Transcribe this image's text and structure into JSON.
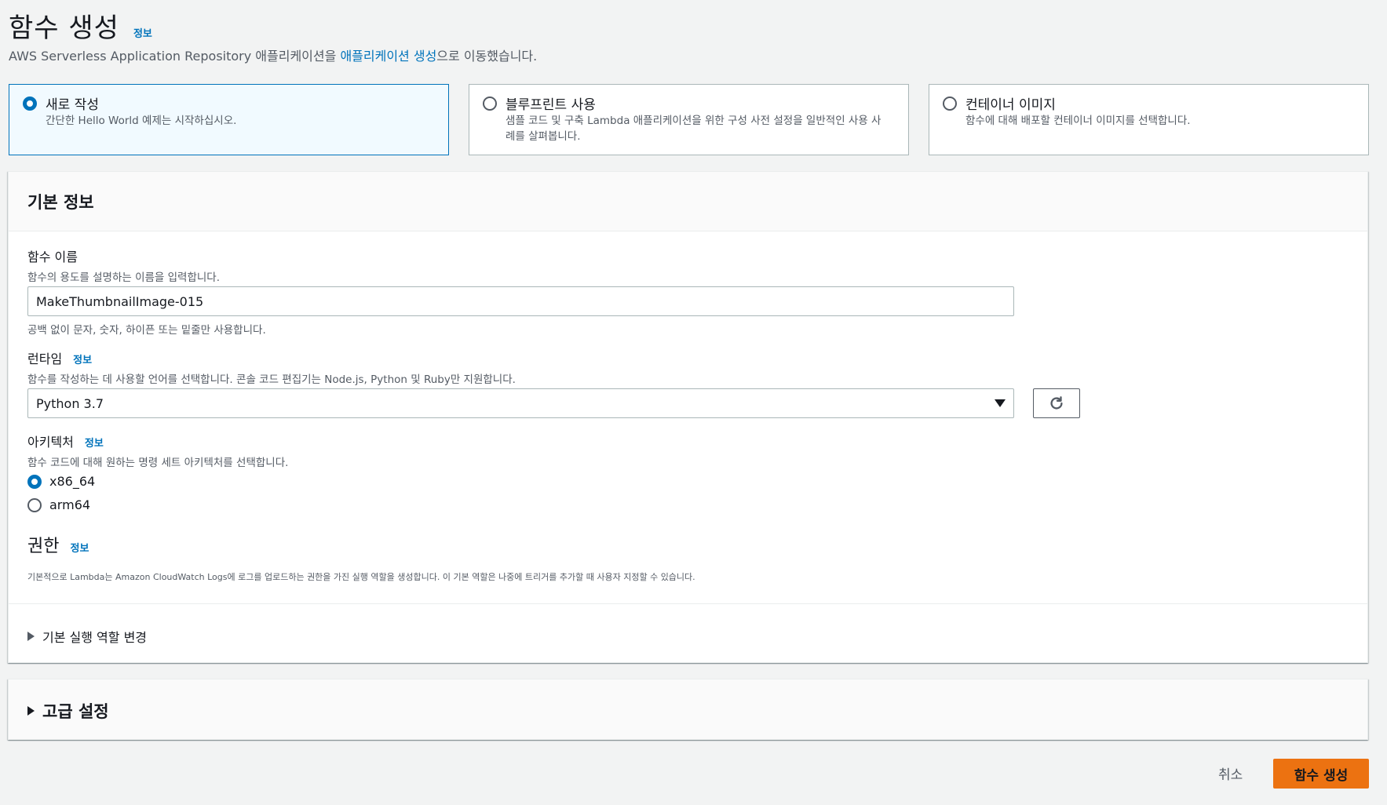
{
  "page": {
    "title": "함수 생성",
    "info": "정보",
    "subtitle_prefix": "AWS Serverless Application Repository 애플리케이션을 ",
    "subtitle_link": "애플리케이션 생성",
    "subtitle_suffix": "으로 이동했습니다."
  },
  "options": [
    {
      "title": "새로 작성",
      "desc": "간단한 Hello World 예제는 시작하십시오.",
      "selected": true
    },
    {
      "title": "블루프린트 사용",
      "desc": "샘플 코드 및 구축 Lambda 애플리케이션을 위한 구성 사전 설정을 일반적인 사용 사례를 살펴봅니다.",
      "selected": false
    },
    {
      "title": "컨테이너 이미지",
      "desc": "함수에 대해 배포할 컨테이너 이미지를 선택합니다.",
      "selected": false
    }
  ],
  "basic": {
    "header": "기본 정보",
    "function_name": {
      "label": "함수 이름",
      "desc": "함수의 용도를 설명하는 이름을 입력합니다.",
      "value": "MakeThumbnailImage-015",
      "constraint": "공백 없이 문자, 숫자, 하이픈 또는 밑줄만 사용합니다."
    },
    "runtime": {
      "label": "런타임",
      "info": "정보",
      "desc": "함수를 작성하는 데 사용할 언어를 선택합니다. 콘솔 코드 편집기는 Node.js, Python 및 Ruby만 지원합니다.",
      "value": "Python 3.7"
    },
    "architecture": {
      "label": "아키텍처",
      "info": "정보",
      "desc": "함수 코드에 대해 원하는 명령 세트 아키텍처를 선택합니다.",
      "options": [
        "x86_64",
        "arm64"
      ],
      "selected": "x86_64"
    },
    "permissions": {
      "title": "권한",
      "info": "정보",
      "desc": "기본적으로 Lambda는 Amazon CloudWatch Logs에 로그를 업로드하는 권한을 가진 실행 역할을 생성합니다. 이 기본 역할은 나중에 트리거를 추가할 때 사용자 지정할 수 있습니다."
    },
    "change_role": "기본 실행 역할 변경"
  },
  "advanced": {
    "label": "고급 설정"
  },
  "footer": {
    "cancel": "취소",
    "create": "함수 생성"
  },
  "colors": {
    "accent": "#0073bb",
    "primary_button": "#ec7211",
    "background": "#f2f3f3"
  }
}
